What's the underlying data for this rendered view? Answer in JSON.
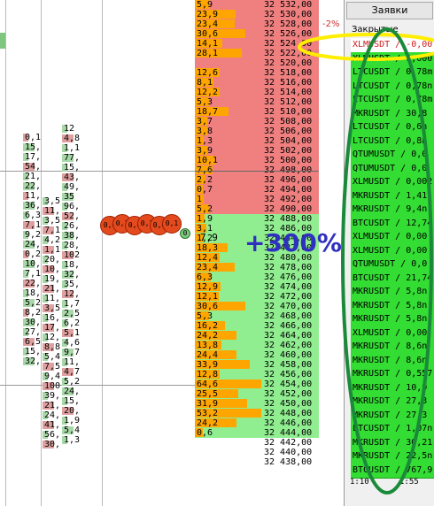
{
  "orders_panel": {
    "tab_label": "Заявки",
    "sub_label": "Закрытые",
    "top_pct": "-2%",
    "rows": [
      "XLMUSDT / -0,00",
      "XLMUSDT / 0,000",
      "LTCUSDT / 0,78m",
      "LTCUSDT / 0,78n",
      "LTCUSDT / 0,78m",
      "MKRUSDT / 30,8",
      "LTCUSDT / 0,6n",
      "LTCUSDT / 0,8n",
      "QTUMUSDT / 0,0",
      "QTUMUSDT / 0,0",
      "XLMUSDT / 0,002",
      "MKRUSDT / 1,41",
      "MKRUSDT / 9,4n",
      "BTCUSDT / 12,74",
      "XLMUSDT / 0,00",
      "XLMUSDT / 0,00",
      "QTUMUSDT / 0,0",
      "BTCUSDT / 21,74",
      "MKRUSDT / 5,8n",
      "MKRUSDT / 5,8n",
      "MKRUSDT / 5,8n",
      "XLMUSDT / 0,00",
      "MKRUSDT / 8,6n",
      "MKRUSDT / 8,6n",
      "MKRUSDT / 0,557",
      "MKRUSDT / 10,9",
      "MKRUSDT / 27,3",
      "MKRUSDT / 27,3",
      "LTCUSDT / 1,07n",
      "MKRUSDT / 30,21",
      "MKRUSDT / 22,5n",
      "BTCUSDT / 767,9"
    ],
    "time_left": "1:10",
    "time_right": "1:55"
  },
  "overlay": {
    "big_label": "+300%",
    "small_val": "7,9",
    "balls": [
      "0,0",
      "0,1",
      "0,0",
      "0,1",
      "0,0",
      "0,1",
      "0"
    ]
  },
  "ladder": {
    "rows": [
      {
        "vol": "5,9",
        "price": "32 532,00",
        "side": "ask"
      },
      {
        "vol": "23,9",
        "price": "32 530,00",
        "side": "ask"
      },
      {
        "vol": "23,4",
        "price": "32 528,00",
        "side": "ask"
      },
      {
        "vol": "30,6",
        "price": "32 526,00",
        "side": "ask"
      },
      {
        "vol": "14,1",
        "price": "32 524,00",
        "side": "ask"
      },
      {
        "vol": "28,1",
        "price": "32 522,00",
        "side": "ask"
      },
      {
        "vol": "",
        "price": "32 520,00",
        "side": "ask"
      },
      {
        "vol": "12,6",
        "price": "32 518,00",
        "side": "ask"
      },
      {
        "vol": "8,1",
        "price": "32 516,00",
        "side": "ask"
      },
      {
        "vol": "12,2",
        "price": "32 514,00",
        "side": "ask"
      },
      {
        "vol": "5,3",
        "price": "32 512,00",
        "side": "ask"
      },
      {
        "vol": "18,7",
        "price": "32 510,00",
        "side": "ask"
      },
      {
        "vol": "3,7",
        "price": "32 508,00",
        "side": "ask"
      },
      {
        "vol": "3,8",
        "price": "32 506,00",
        "side": "ask"
      },
      {
        "vol": "1,3",
        "price": "32 504,00",
        "side": "ask"
      },
      {
        "vol": "3,9",
        "price": "32 502,00",
        "side": "ask"
      },
      {
        "vol": "10,1",
        "price": "32 500,00",
        "side": "ask"
      },
      {
        "vol": "7,6",
        "price": "32 498,00",
        "side": "ask"
      },
      {
        "vol": "2,2",
        "price": "32 496,00",
        "side": "ask"
      },
      {
        "vol": "0,7",
        "price": "32 494,00",
        "side": "ask"
      },
      {
        "vol": "1",
        "price": "32 492,00",
        "side": "ask"
      },
      {
        "vol": "5,2",
        "price": "32 490,00",
        "side": "ask"
      },
      {
        "vol": "1,9",
        "price": "32 488,00",
        "side": "bid"
      },
      {
        "vol": "3,1",
        "price": "32 486,00",
        "side": "bid"
      },
      {
        "vol": "1,2",
        "price": "32 484,00",
        "side": "bid"
      },
      {
        "vol": "18,3",
        "price": "32 482,00",
        "side": "bid"
      },
      {
        "vol": "12,4",
        "price": "32 480,00",
        "side": "bid"
      },
      {
        "vol": "23,4",
        "price": "32 478,00",
        "side": "bid"
      },
      {
        "vol": "6,3",
        "price": "32 476,00",
        "side": "bid"
      },
      {
        "vol": "12,9",
        "price": "32 474,00",
        "side": "bid"
      },
      {
        "vol": "12,1",
        "price": "32 472,00",
        "side": "bid"
      },
      {
        "vol": "30,6",
        "price": "32 470,00",
        "side": "bid"
      },
      {
        "vol": "5,3",
        "price": "32 468,00",
        "side": "bid"
      },
      {
        "vol": "16,2",
        "price": "32 466,00",
        "side": "bid"
      },
      {
        "vol": "24,2",
        "price": "32 464,00",
        "side": "bid"
      },
      {
        "vol": "13,8",
        "price": "32 462,00",
        "side": "bid"
      },
      {
        "vol": "24,4",
        "price": "32 460,00",
        "side": "bid"
      },
      {
        "vol": "33,9",
        "price": "32 458,00",
        "side": "bid"
      },
      {
        "vol": "12,8",
        "price": "32 456,00",
        "side": "bid"
      },
      {
        "vol": "64,6",
        "price": "32 454,00",
        "side": "bid"
      },
      {
        "vol": "25,5",
        "price": "32 452,00",
        "side": "bid"
      },
      {
        "vol": "31,9",
        "price": "32 450,00",
        "side": "bid"
      },
      {
        "vol": "53,2",
        "price": "32 448,00",
        "side": "bid"
      },
      {
        "vol": "24,2",
        "price": "32 446,00",
        "side": "bid"
      },
      {
        "vol": "0,6",
        "price": "32 444,00",
        "side": "bid"
      },
      {
        "vol": "",
        "price": "32 442,00",
        "side": "none"
      },
      {
        "vol": "",
        "price": "32 440,00",
        "side": "none"
      },
      {
        "vol": "",
        "price": "32 438,00",
        "side": "none"
      }
    ]
  },
  "left_cols": {
    "c1": [
      "0,1",
      "15,",
      "17,",
      "54,",
      "21,",
      "22,",
      "11,",
      "36,",
      "6,3",
      "7,1",
      "9,2",
      "24,",
      "0,2",
      "10,",
      "7,1",
      "22,",
      "18,",
      "5,2",
      "8,2",
      "30,",
      "27,",
      "6,5",
      "15,",
      "32,"
    ],
    "c2": [
      "3,5",
      "11,",
      "3,5",
      "7,1",
      "4,2",
      "1,1",
      "20,",
      "10,",
      "19,",
      "21,",
      "11,",
      "3,5",
      "16,",
      "17,",
      "12,",
      "8,8",
      "5,4",
      "7,5",
      "9,4",
      "100",
      "39,",
      "21,",
      "24,",
      "41,",
      "56,",
      "30,"
    ],
    "c3": [
      "12",
      "4,8",
      "1,1",
      "77,",
      "15,",
      "43,",
      "49,",
      "35",
      "96,",
      "52,",
      "26,",
      "38,",
      "28,",
      "102",
      "18,",
      "32,",
      "35,",
      "12,",
      "1,7",
      "2,5",
      "6,2",
      "5,1",
      "4,6",
      "9,7",
      "11,",
      "4,7",
      "5,2",
      "24,",
      "15,",
      "20,",
      "1,9",
      "5,4",
      "1,3"
    ],
    "c4": [
      "1,4"
    ]
  }
}
